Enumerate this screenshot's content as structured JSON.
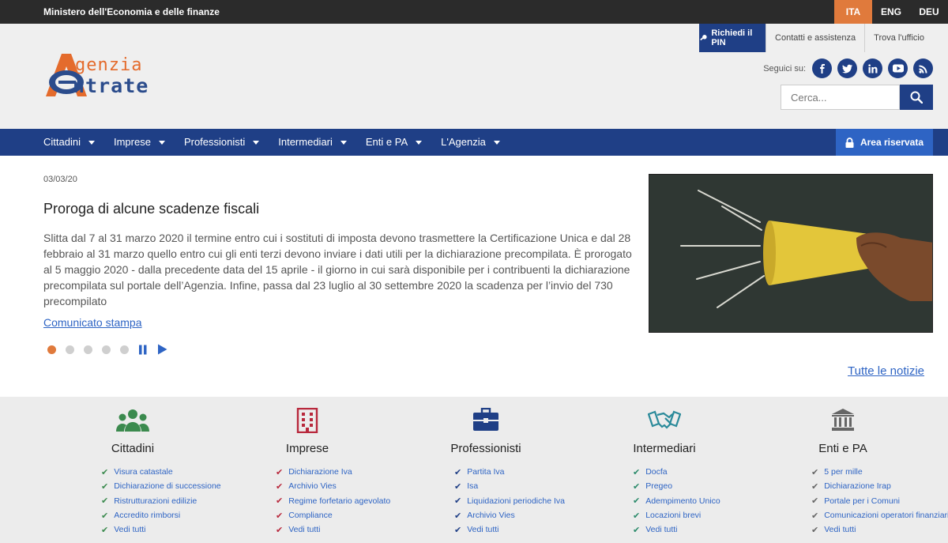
{
  "topbar": {
    "ministry": "Ministero dell'Economia e delle finanze",
    "languages": [
      "ITA",
      "ENG",
      "DEU"
    ],
    "active_language": "ITA"
  },
  "header": {
    "logo_line1": "genzia",
    "logo_line2": "ntrate",
    "pin_label": "Richiedi il PIN",
    "contacts_label": "Contatti e assistenza",
    "office_label": "Trova l'ufficio",
    "follow_label": "Seguici su:",
    "social_icons": [
      "facebook-icon",
      "twitter-icon",
      "linkedin-icon",
      "youtube-icon",
      "rss-icon"
    ],
    "search_placeholder": "Cerca..."
  },
  "nav": {
    "items": [
      {
        "label": "Cittadini"
      },
      {
        "label": "Imprese"
      },
      {
        "label": "Professionisti"
      },
      {
        "label": "Intermediari"
      },
      {
        "label": "Enti e PA"
      },
      {
        "label": "L'Agenzia"
      }
    ],
    "area_riservata": "Area riservata"
  },
  "news": {
    "date": "03/03/20",
    "title": "Proroga di alcune scadenze fiscali",
    "body": "Slitta dal 7 al 31 marzo 2020 il termine entro cui i sostituti di imposta devono trasmettere la Certificazione Unica e dal 28 febbraio al 31 marzo quello entro cui gli enti terzi devono inviare i dati utili per la dichiarazione precompilata. È prorogato al 5 maggio 2020 - dalla precedente data del 15 aprile - il giorno in cui sarà disponibile per i contribuenti la dichiarazione precompilata sul portale dell’Agenzia. Infine, passa dal 23 luglio al 30 settembre 2020 la scadenza per l’invio del 730 precompilato",
    "link": "Comunicato stampa",
    "slides": 5,
    "active_slide": 1,
    "all_news": "Tutte le notizie"
  },
  "categories": [
    {
      "title": "Cittadini",
      "icon": "people-icon",
      "color": "#3b8a4e",
      "check_color": "#3b8a4e",
      "links": [
        "Visura catastale",
        "Dichiarazione di successione",
        "Ristrutturazioni edilizie",
        "Accredito rimborsi",
        "Vedi tutti"
      ]
    },
    {
      "title": "Imprese",
      "icon": "building-icon",
      "color": "#c0392b",
      "check_color": "#b8283c",
      "links": [
        "Dichiarazione Iva",
        "Archivio Vies",
        "Regime forfetario agevolato",
        "Compliance",
        "Vedi tutti"
      ]
    },
    {
      "title": "Professionisti",
      "icon": "briefcase-icon",
      "color": "#1f3f86",
      "check_color": "#1f3f86",
      "links": [
        "Partita Iva",
        "Isa",
        "Liquidazioni periodiche Iva",
        "Archivio Vies",
        "Vedi tutti"
      ]
    },
    {
      "title": "Intermediari",
      "icon": "handshake-icon",
      "color": "#2a8a9a",
      "check_color": "#2a8a6a",
      "links": [
        "Docfa",
        "Pregeo",
        "Adempimento Unico",
        "Locazioni brevi",
        "Vedi tutti"
      ]
    },
    {
      "title": "Enti e PA",
      "icon": "institution-icon",
      "color": "#666666",
      "check_color": "#666666",
      "links": [
        "5 per mille",
        "Dichiarazione Irap",
        "Portale per i Comuni",
        "Comunicazioni operatori finanziari",
        "Vedi tutti"
      ]
    }
  ]
}
